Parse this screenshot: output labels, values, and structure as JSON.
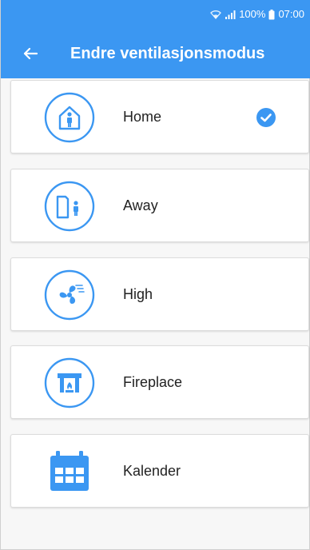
{
  "status_bar": {
    "battery": "100%",
    "time": "07:00",
    "icons": [
      "wifi-icon",
      "signal-icon",
      "battery-icon"
    ]
  },
  "app_bar": {
    "title": "Endre ventilasjonsmodus",
    "back_icon": "arrow-left-icon"
  },
  "modes": [
    {
      "label": "Home",
      "icon": "home-person-icon",
      "selected": true
    },
    {
      "label": "Away",
      "icon": "away-door-person-icon",
      "selected": false
    },
    {
      "label": "High",
      "icon": "fan-icon",
      "selected": false
    },
    {
      "label": "Fireplace",
      "icon": "fireplace-icon",
      "selected": false
    },
    {
      "label": "Kalender",
      "icon": "calendar-icon",
      "selected": false
    }
  ],
  "colors": {
    "primary": "#3b97f2",
    "background": "#f7f7f7",
    "card": "#ffffff",
    "text": "#222222"
  }
}
